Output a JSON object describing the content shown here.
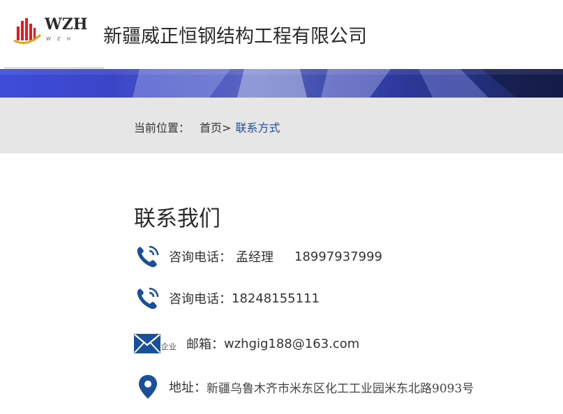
{
  "header": {
    "logo_text": "WZH",
    "logo_sub": "WZH",
    "company_name": "新疆威正恒钢结构工程有限公司"
  },
  "breadcrumb": {
    "prefix": "当前位置：",
    "home": "首页>",
    "current": "联系方式"
  },
  "contact": {
    "title": "联系我们",
    "rows": [
      {
        "icon": "phone-icon",
        "label": "咨询电话：",
        "name": "孟经理",
        "value": "18997937999"
      },
      {
        "icon": "phone-icon",
        "label": "咨询电话：",
        "value": "18248155111"
      },
      {
        "icon": "mail-icon",
        "icon_tag": "企业",
        "label": "邮箱：",
        "value": "wzhgig188@163.com"
      },
      {
        "icon": "location-pin-icon",
        "label": "地址：",
        "value": "新疆乌鲁木齐市米东区化工工业园米东北路9093号"
      }
    ]
  },
  "colors": {
    "accent_blue": "#1f4fa0",
    "icon_blue": "#1a4f9a",
    "breadcrumb_bg": "#e6e6e6",
    "logo_red": "#d71f26",
    "logo_gold": "#e8a21a"
  }
}
